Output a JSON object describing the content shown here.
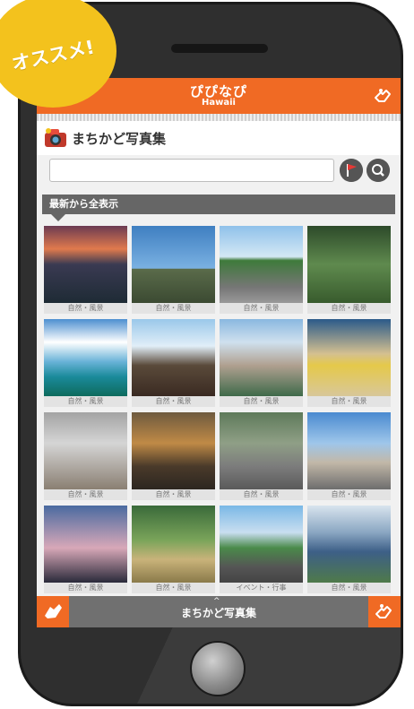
{
  "badge": {
    "text": "オススメ!"
  },
  "header": {
    "logo_main": "ぴぴなぴ",
    "logo_sub": "Hawaii"
  },
  "page": {
    "title": "まちかど写真集"
  },
  "search": {
    "value": "",
    "placeholder": ""
  },
  "section": {
    "label": "最新から全表示"
  },
  "photos": [
    {
      "tag": "自然・風景",
      "scene": "sunset-city"
    },
    {
      "tag": "自然・風景",
      "scene": "mountain-sky"
    },
    {
      "tag": "自然・風景",
      "scene": "road-palms"
    },
    {
      "tag": "自然・風景",
      "scene": "park-trees"
    },
    {
      "tag": "自然・風景",
      "scene": "ocean-islands"
    },
    {
      "tag": "自然・風景",
      "scene": "shrine-gate"
    },
    {
      "tag": "自然・風景",
      "scene": "church"
    },
    {
      "tag": "自然・風景",
      "scene": "canoes-beach"
    },
    {
      "tag": "自然・風景",
      "scene": "arcade"
    },
    {
      "tag": "自然・風景",
      "scene": "sunset-buildings"
    },
    {
      "tag": "自然・風景",
      "scene": "hillside-street"
    },
    {
      "tag": "自然・風景",
      "scene": "shopping-street"
    },
    {
      "tag": "自然・風景",
      "scene": "sunset-palms"
    },
    {
      "tag": "自然・風景",
      "scene": "surfboards"
    },
    {
      "tag": "イベント・行事",
      "scene": "parade-truck"
    },
    {
      "tag": "自然・風景",
      "scene": "highrise"
    }
  ],
  "footer": {
    "title": "まちかど写真集"
  },
  "colors": {
    "accent": "#f06a24",
    "badge": "#f3c21d",
    "bar": "#707070"
  }
}
